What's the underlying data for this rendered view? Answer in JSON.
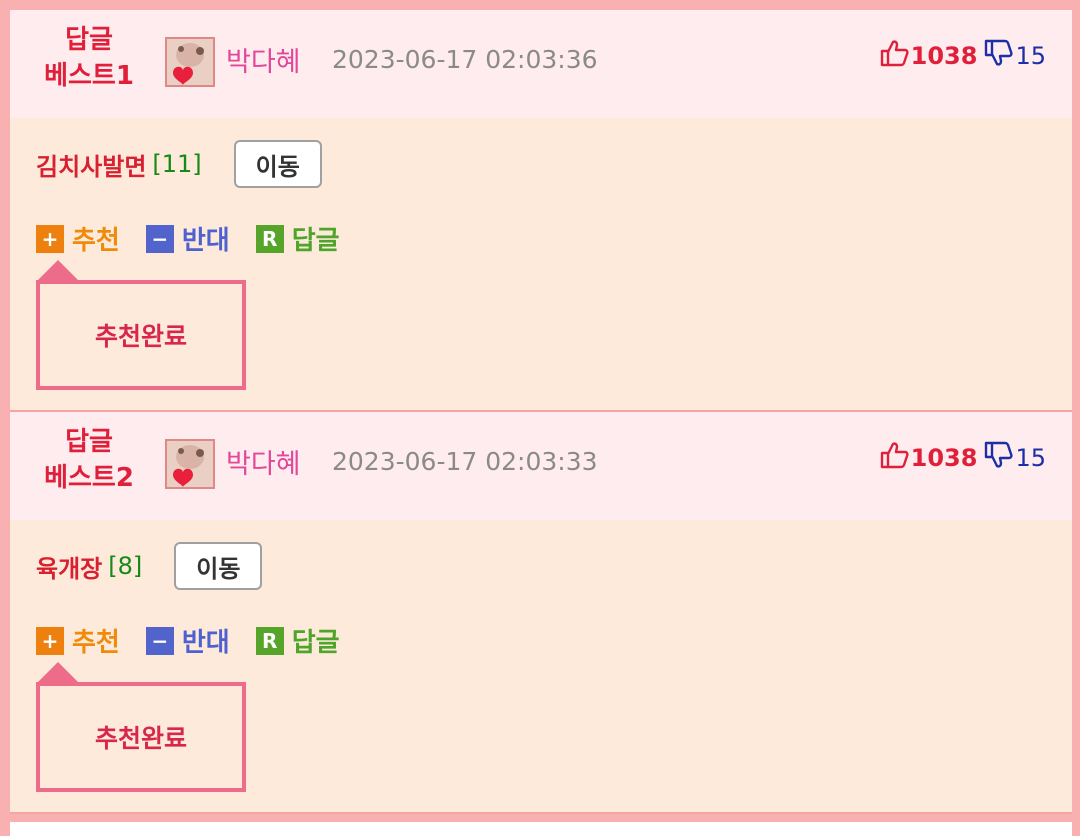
{
  "comments": [
    {
      "best_label": "답글\n베스트1",
      "username": "박다혜",
      "timestamp": "2023-06-17 02:03:36",
      "likes": "1038",
      "dislikes": "15",
      "text": "김치사발면",
      "reply_count": "[11]",
      "move_label": "이동",
      "actions": {
        "recommend": "추천",
        "oppose": "반대",
        "reply": "답글"
      },
      "tooltip": "추천완료"
    },
    {
      "best_label": "답글\n베스트2",
      "username": "박다혜",
      "timestamp": "2023-06-17 02:03:33",
      "likes": "1038",
      "dislikes": "15",
      "text": "육개장",
      "reply_count": "[8]",
      "move_label": "이동",
      "actions": {
        "recommend": "추천",
        "oppose": "반대",
        "reply": "답글"
      },
      "tooltip": "추천완료"
    }
  ],
  "icons": {
    "like": "thumbs-up-icon",
    "dislike": "thumbs-down-icon",
    "plus": "plus-box-icon",
    "minus": "minus-box-icon",
    "reply": "r-box-icon"
  },
  "colors": {
    "header_bg": "#ffecee",
    "body_bg": "#fdeadb",
    "border": "#f8b0b0",
    "accent_red": "#e0203a"
  }
}
